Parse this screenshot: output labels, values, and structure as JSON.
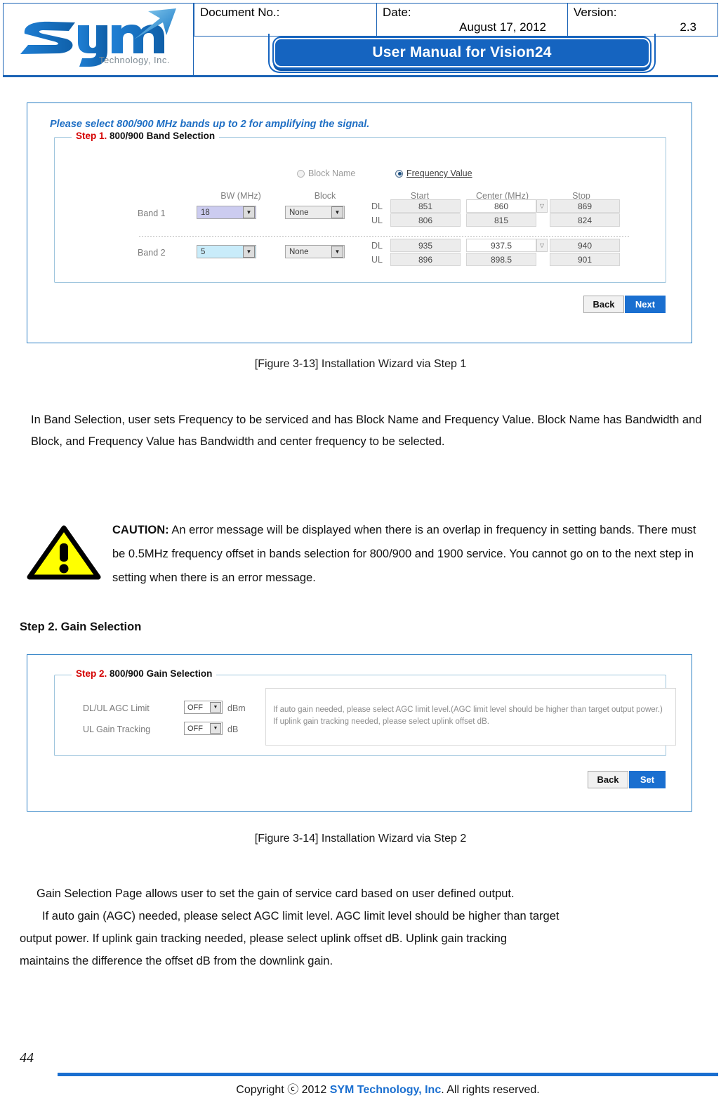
{
  "header": {
    "logo": {
      "brand": "sym",
      "tagline": "Technology, Inc."
    },
    "fields": [
      {
        "label": "Document No.:",
        "value": ""
      },
      {
        "label": "Date:",
        "value": "August 17, 2012"
      },
      {
        "label": "Version:",
        "value": "2.3"
      }
    ],
    "banner_title": "User Manual for Vision24"
  },
  "figure1": {
    "hint": "Please select 800/900 MHz bands up to 2 for amplifying the signal.",
    "legend_step": "Step 1.",
    "legend_rest": " 800/900 Band Selection",
    "radios": [
      {
        "label": "Block Name",
        "selected": false
      },
      {
        "label": "Frequency Value",
        "selected": true
      }
    ],
    "columns": {
      "bw": "BW (MHz)",
      "block": "Block",
      "start": "Start",
      "center": "Center (MHz)",
      "stop": "Stop"
    },
    "rows": [
      {
        "band": "Band 1",
        "bw": "18",
        "block": "None",
        "dl_tag": "DL",
        "ul_tag": "UL",
        "dl_start": "851",
        "dl_center": "860",
        "dl_stop": "869",
        "ul_start": "806",
        "ul_center": "815",
        "ul_stop": "824"
      },
      {
        "band": "Band 2",
        "bw": "5",
        "block": "None",
        "dl_tag": "DL",
        "ul_tag": "UL",
        "dl_start": "935",
        "dl_center": "937.5",
        "dl_stop": "940",
        "ul_start": "896",
        "ul_center": "898.5",
        "ul_stop": "901"
      }
    ],
    "buttons": {
      "back": "Back",
      "next": "Next"
    },
    "caption": "[Figure 3-13] Installation Wizard via Step 1"
  },
  "figure2": {
    "legend_step": "Step 2.",
    "legend_rest": " 800/900 Gain Selection",
    "fields": [
      {
        "label": "DL/UL AGC Limit",
        "value": "OFF",
        "unit": "dBm"
      },
      {
        "label": "UL Gain Tracking",
        "value": "OFF",
        "unit": "dB"
      }
    ],
    "info_lines": [
      "If auto gain needed, please select AGC limit level.(AGC limit level should be higher than target output power.)",
      "If uplink gain tracking needed, please select uplink offset dB."
    ],
    "buttons": {
      "back": "Back",
      "set": "Set"
    },
    "caption": "[Figure 3-14] Installation Wizard via Step 2"
  },
  "body": {
    "para1_line1": "In Band Selection, user sets Frequency to be serviced and has Block Name and Frequency Value. Block",
    "para1_line2": "Name has Bandwidth and Block, and Frequency Value has Bandwidth and center frequency to be",
    "para1_line3": "selected.",
    "caution_label": "CAUTION:",
    "caution_body": " An error message will be displayed when there is an overlap in frequency in setting bands. There must be 0.5MHz frequency offset in bands selection for 800/900 and 1900 service. You cannot go on to the next step in setting when there is an error message.",
    "step2_heading": "Step 2. Gain Selection",
    "para2_line1": "Gain Selection Page allows user to set the gain of service card based on user defined output.",
    "para2_line2": "If auto gain (AGC) needed, please select AGC limit level. AGC limit level should be higher than target",
    "para2_line3": "output power. If uplink gain tracking needed, please select uplink offset dB. Uplink gain tracking",
    "para2_line4": "maintains the difference the offset dB from the downlink gain."
  },
  "footer": {
    "page_number": "44",
    "copyright_pre": "Copyright ⓒ 2012 ",
    "copyright_brand": "SYM Technology, Inc",
    "copyright_post": ". All rights reserved."
  },
  "colors": {
    "accent_blue": "#1a6fd0",
    "border_blue": "#1b63b5",
    "caution_yellow": "#ffff00",
    "step_red": "#d40000"
  }
}
